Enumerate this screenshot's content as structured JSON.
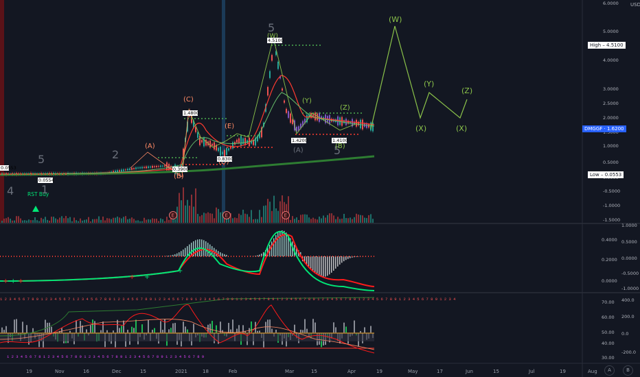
{
  "app": {
    "currency": "USD"
  },
  "symbol_badge": {
    "label": "DMGGF",
    "price": "1.6200"
  },
  "price_axis": {
    "labels": [
      "6.0000",
      "5.0000",
      "4.0000",
      "3.0000",
      "2.5000",
      "2.0000",
      "1.5000",
      "1.0000",
      "0.5000",
      "0.0000",
      "-0.5000",
      "-1.0000",
      "-1.5000"
    ],
    "high_label": "High",
    "high_value": "4.5100",
    "low_label": "Low",
    "low_value": "0.0553"
  },
  "macd_axis": {
    "outer": [
      "1.0000",
      "0.5000",
      "0.0000",
      "-0.5000",
      "-1.0000"
    ],
    "inner": [
      "0.4000",
      "0.2000",
      "0.0000"
    ]
  },
  "osc_axis": {
    "outer": [
      "400.0",
      "200.0",
      "0.0",
      "-200.0"
    ],
    "inner": [
      "70.00",
      "60.00",
      "50.00",
      "40.00",
      "30.00"
    ]
  },
  "time_axis": [
    "19",
    "Nov",
    "16",
    "Dec",
    "15",
    "2021",
    "18",
    "Feb",
    "Mar",
    "15",
    "Apr",
    "19",
    "May",
    "17",
    "Jun",
    "15",
    "Jul",
    "19",
    "Aug"
  ],
  "wave_labels": {
    "n1": "1",
    "n2": "2",
    "n4": "4",
    "n5a": "5",
    "n5b": "5",
    "n5c": "5",
    "A1": "(A)",
    "B1": "(B)",
    "C1": "(C)",
    "D1": "(D)",
    "E1": "(E)",
    "W": "(W)",
    "X": "(X)",
    "Y": "(Y)",
    "Z": "(Z)",
    "A2": "(A)",
    "B2": "(B)",
    "Wp": "(W)",
    "Xp1": "(X)",
    "Yp": "(Y)",
    "Xp2": "(X)",
    "Zp": "(Z)",
    "earn": "E"
  },
  "price_tags": {
    "t1": "0.0553",
    "t2": "1.4800",
    "t3": "0.3900",
    "t4": "0.8300",
    "t5": "4.5100",
    "t6": "1.4200",
    "t7": "1.4100",
    "t8": "0.0554"
  },
  "signals": {
    "buy": "RST Buy"
  },
  "corner_buttons": {
    "auto": "A",
    "settings": "B"
  },
  "colors": {
    "up": "#26a69a",
    "down": "#ef5350",
    "wave": "#8bc34a",
    "signal": "#ff0000"
  }
}
